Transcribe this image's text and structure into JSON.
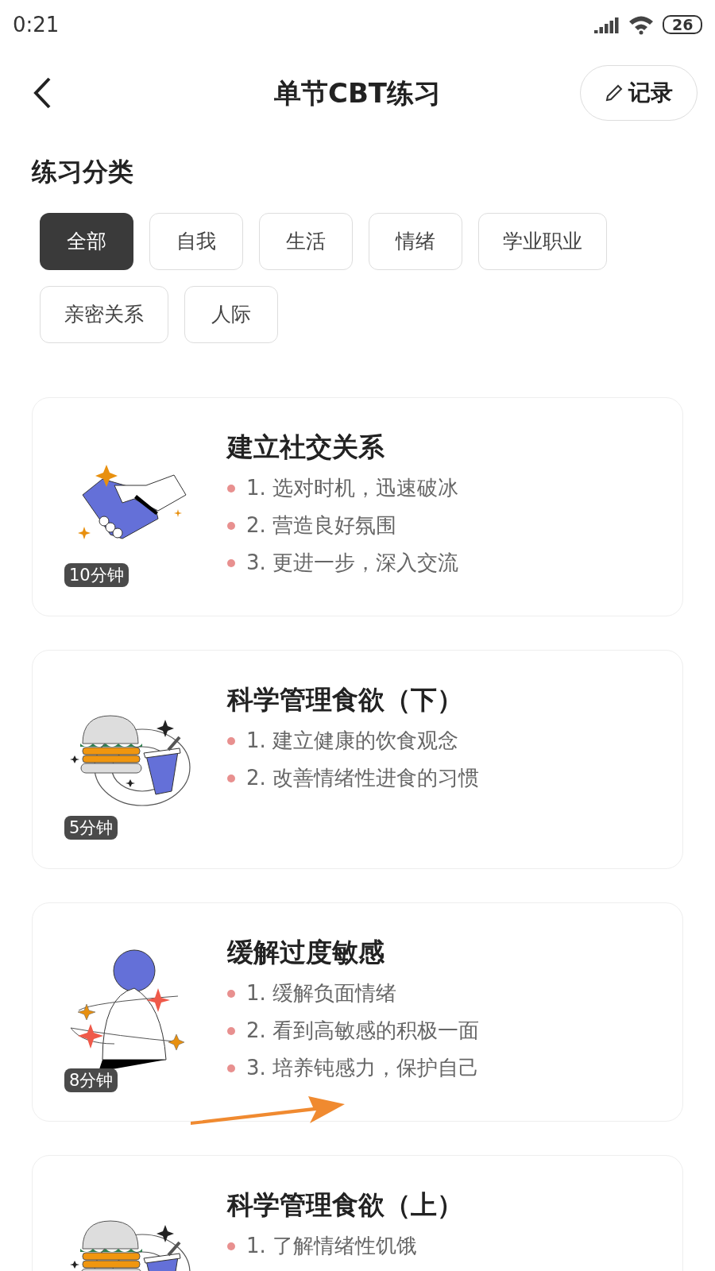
{
  "status_bar": {
    "time": "0:21",
    "battery": "26"
  },
  "header": {
    "title": "单节CBT练习",
    "record_button": "记录"
  },
  "section_title": "练习分类",
  "categories": [
    {
      "label": "全部",
      "selected": true
    },
    {
      "label": "自我",
      "selected": false
    },
    {
      "label": "生活",
      "selected": false
    },
    {
      "label": "情绪",
      "selected": false
    },
    {
      "label": "学业职业",
      "selected": false
    },
    {
      "label": "亲密关系",
      "selected": false
    },
    {
      "label": "人际",
      "selected": false
    }
  ],
  "exercises": [
    {
      "kind": "handshake",
      "title": "建立社交关系",
      "duration": "10分钟",
      "points": [
        "1. 选对时机，迅速破冰",
        "2. 营造良好氛围",
        "3. 更进一步，深入交流"
      ]
    },
    {
      "kind": "food",
      "title": "科学管理食欲（下）",
      "duration": "5分钟",
      "points": [
        "1. 建立健康的饮食观念",
        "2. 改善情绪性进食的习惯"
      ]
    },
    {
      "kind": "figure",
      "title": "缓解过度敏感",
      "duration": "8分钟",
      "points": [
        "1. 缓解负面情绪",
        "2. 看到高敏感的积极一面",
        "3. 培养钝感力，保护自己"
      ]
    },
    {
      "kind": "food",
      "title": "科学管理食欲（上）",
      "points": [
        "1. 了解情绪性饥饿"
      ]
    }
  ]
}
